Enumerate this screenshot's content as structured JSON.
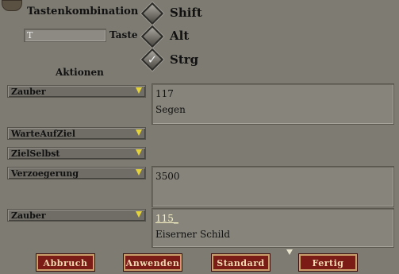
{
  "header": {
    "title": "Tastenkombination"
  },
  "key": {
    "value": "T",
    "label": "Taste"
  },
  "modifiers": [
    {
      "label": "Shift",
      "checked": false
    },
    {
      "label": "Alt",
      "checked": false
    },
    {
      "label": "Strg",
      "checked": true
    }
  ],
  "actions": {
    "heading": "Aktionen",
    "rows": [
      {
        "type": "Zauber",
        "params": [
          "117",
          "Segen"
        ]
      },
      {
        "type": "WarteAufZiel",
        "params": []
      },
      {
        "type": "ZielSelbst",
        "params": []
      },
      {
        "type": "Verzoegerung",
        "params": [
          "3500"
        ]
      },
      {
        "type": "Zauber",
        "params": [
          "115_",
          "Eiserner Schild"
        ]
      }
    ]
  },
  "buttons": {
    "cancel": "Abbruch",
    "apply": "Anwenden",
    "default": "Standard",
    "done": "Fertig"
  },
  "icons": {
    "check": "✓",
    "dropdown": "dropdown-arrow-icon"
  },
  "colors": {
    "button_bg": "#7b1c17",
    "button_border": "#c9a06c",
    "arrow": "#e4d33a"
  }
}
